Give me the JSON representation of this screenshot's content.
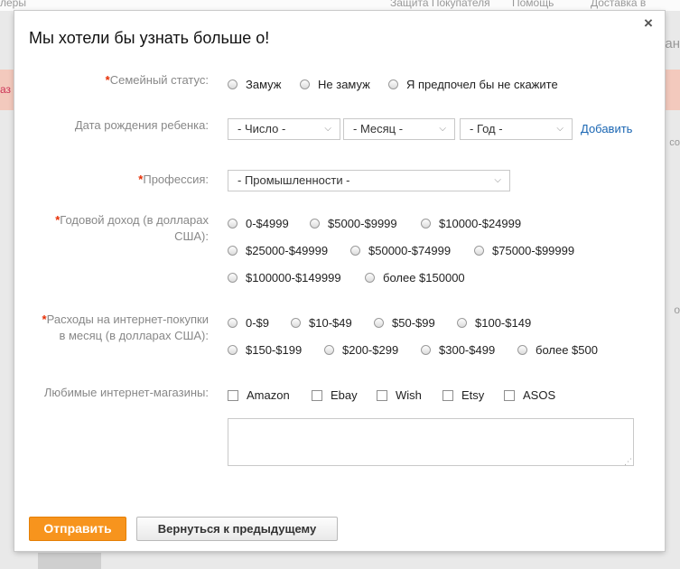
{
  "background": {
    "top_left": "леры",
    "top_mid1": "Защита Покупателя",
    "top_mid2": "Помощь",
    "top_right": "Доставка в",
    "band_left": "аз",
    "right_1": "ан",
    "right_2": "со",
    "right_3": "о"
  },
  "modal": {
    "title": "Мы хотели бы узнать больше о!",
    "close": "×",
    "marital": {
      "label": "Семейный статус:",
      "options": [
        "Замуж",
        "Не замуж",
        "Я предпочел бы не скажите"
      ]
    },
    "child_birth": {
      "label": "Дата рождения ребенка:",
      "day": "- Число -",
      "month": "- Месяц -",
      "year": "- Год -",
      "add": "Добавить"
    },
    "profession": {
      "label": "Профессия:",
      "value": "- Промышленности -"
    },
    "income": {
      "label_line1": "Годовой доход (в долларах",
      "label_line2": "США):",
      "options": [
        "0-$4999",
        "$5000-$9999",
        "$10000-$24999",
        "$25000-$49999",
        "$50000-$74999",
        "$75000-$99999",
        "$100000-$149999",
        "более $150000"
      ]
    },
    "spend": {
      "label_line1": "Расходы на интернет-покупки",
      "label_line2": "в месяц (в долларах США):",
      "options": [
        "0-$9",
        "$10-$49",
        "$50-$99",
        "$100-$149",
        "$150-$199",
        "$200-$299",
        "$300-$499",
        "более $500"
      ]
    },
    "stores": {
      "label": "Любимые интернет-магазины:",
      "options": [
        "Amazon",
        "Ebay",
        "Wish",
        "Etsy",
        "ASOS"
      ]
    },
    "buttons": {
      "submit": "Отправить",
      "back": "Вернуться к предыдущему"
    }
  },
  "colors": {
    "accent": "#f7941d",
    "required": "#e62e04",
    "link": "#1a66b3"
  }
}
